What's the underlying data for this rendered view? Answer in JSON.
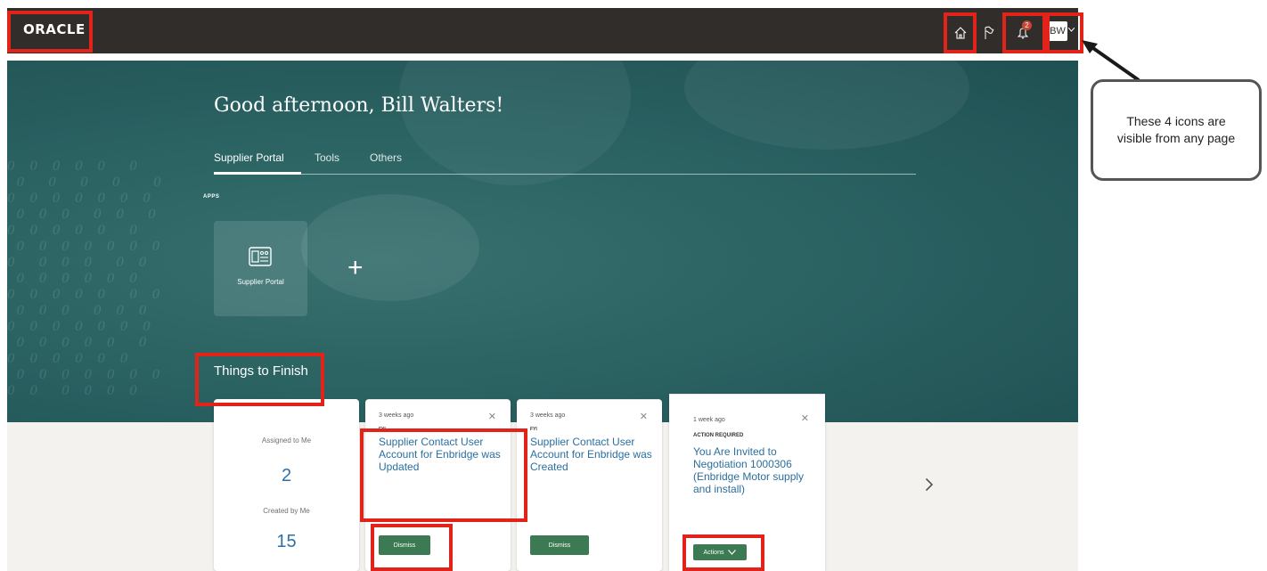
{
  "topbar": {
    "logo": "ORACLE",
    "avatar_initials": "BW",
    "notification_count": "2"
  },
  "hero": {
    "greeting": "Good afternoon, Bill Walters!",
    "tabs": [
      {
        "label": "Supplier Portal"
      },
      {
        "label": "Tools"
      },
      {
        "label": "Others"
      }
    ],
    "apps_label": "APPS",
    "app_tiles": [
      {
        "label": "Supplier Portal",
        "icon": "portal-icon"
      }
    ],
    "add_symbol": "+",
    "things_to_finish": "Things to Finish"
  },
  "counts": {
    "assigned_label": "Assigned to Me",
    "assigned_value": "2",
    "created_label": "Created by Me",
    "created_value": "15"
  },
  "notifications": [
    {
      "time": "3 weeks ago",
      "type": "FYI",
      "title": "Supplier Contact User Account for Enbridge was Updated",
      "button": "Dismiss"
    },
    {
      "time": "3 weeks ago",
      "type": "FYI",
      "title": "Supplier Contact User Account for Enbridge was Created",
      "button": "Dismiss"
    },
    {
      "time": "1 week ago",
      "type": "ACTION REQUIRED",
      "title": "You Are Invited to Negotiation 1000306 (Enbridge Motor supply and install)",
      "button": "Actions"
    }
  ],
  "callout": {
    "text": "These 4 icons are visible from any page"
  },
  "colors": {
    "topbar": "#312d2a",
    "hero": "#2c6464",
    "highlight": "#e2231a",
    "link": "#2a6f9f",
    "button": "#3b7a52"
  }
}
